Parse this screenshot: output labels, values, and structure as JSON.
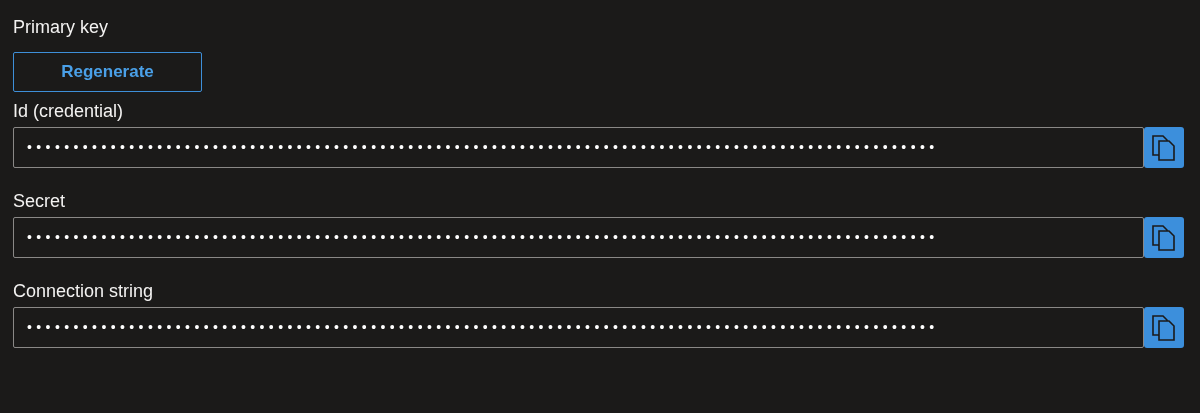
{
  "section_title": "Primary key",
  "regenerate_button": "Regenerate",
  "fields": [
    {
      "label": "Id (credential)",
      "value": "••••••••••••••••••••••••••••••••••••••••••••••••••••••••••••••••••••••••••••••••••••••••••••••••••"
    },
    {
      "label": "Secret",
      "value": "••••••••••••••••••••••••••••••••••••••••••••••••••••••••••••••••••••••••••••••••••••••••••••••••••"
    },
    {
      "label": "Connection string",
      "value": "••••••••••••••••••••••••••••••••••••••••••••••••••••••••••••••••••••••••••••••••••••••••••••••••••"
    }
  ]
}
